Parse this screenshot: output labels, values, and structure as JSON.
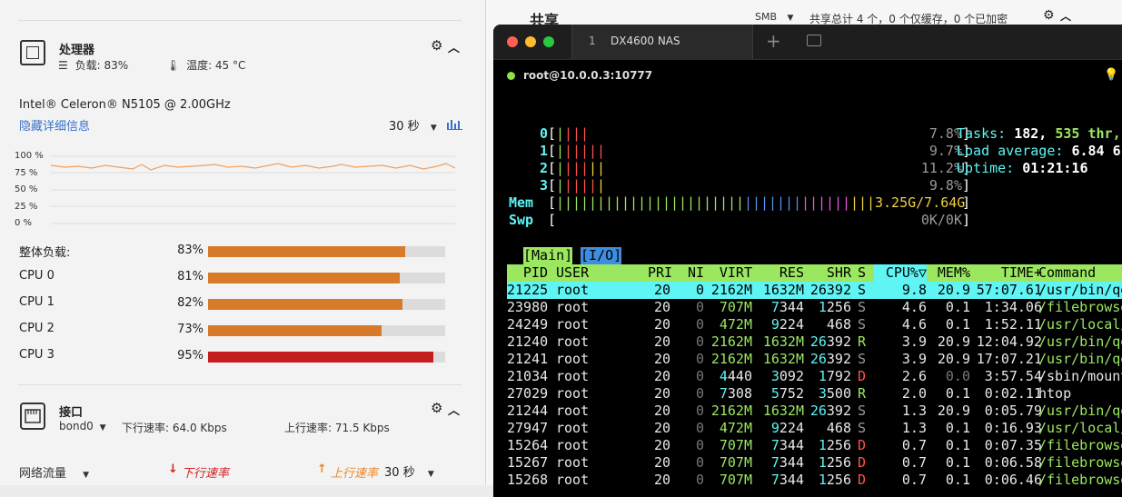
{
  "processor": {
    "title": "处理器",
    "load_label": "负载: 83%",
    "temp_label": "温度: 45 °C",
    "cpu_model": "Intel® Celeron® N5105 @ 2.00GHz",
    "hide_details": "隐藏详细信息",
    "interval": "30 秒",
    "axis_labels": [
      "100 %",
      "75 %",
      "50 %",
      "25 %",
      "0 %"
    ],
    "rows": [
      {
        "label": "整体负载:",
        "pct": "83%",
        "value": 83,
        "color": "#d77a2a"
      },
      {
        "label": "CPU 0",
        "pct": "81%",
        "value": 81,
        "color": "#d77a2a"
      },
      {
        "label": "CPU 1",
        "pct": "82%",
        "value": 82,
        "color": "#d77a2a"
      },
      {
        "label": "CPU 2",
        "pct": "73%",
        "value": 73,
        "color": "#d77a2a"
      },
      {
        "label": "CPU 3",
        "pct": "95%",
        "value": 95,
        "color": "#c41e1e"
      }
    ]
  },
  "interface": {
    "title": "接口",
    "adapter": "bond0",
    "down_rate": "下行速率: 64.0 Kbps",
    "up_rate": "上行速率: 71.5 Kbps",
    "traffic_label": "网络流量",
    "down_legend": "下行速率",
    "up_legend": "上行速率",
    "interval": "30 秒"
  },
  "share": {
    "title": "共享",
    "protocol": "SMB",
    "summary": "共享总计 4 个，0 个仅缓存，0 个已加密"
  },
  "terminal": {
    "tab_index": "1",
    "tab_title": "DX4600 NAS",
    "session": "root@10.0.0.3:10777",
    "cpu_bars": [
      {
        "id": "0",
        "percent": "7.8%"
      },
      {
        "id": "1",
        "percent": "9.7%"
      },
      {
        "id": "2",
        "percent": "11.2%"
      },
      {
        "id": "3",
        "percent": "9.8%"
      }
    ],
    "mem_label": "Mem",
    "mem_value": "3.25G/7.64G",
    "swp_label": "Swp",
    "swp_value": "0K/0K",
    "tasks_label": "Tasks:",
    "tasks_value": "182,",
    "threads_value": "535 thr,",
    "load_label": "Load average:",
    "load_value": "6.84 6",
    "uptime_label": "Uptime:",
    "uptime_value": "01:21:16",
    "tab_main": "[Main]",
    "tab_io": "[I/O]",
    "columns": [
      "PID",
      "USER",
      "PRI",
      "NI",
      "VIRT",
      "RES",
      "SHR",
      "S",
      "CPU%▽",
      "MEM%",
      "TIME+",
      "Command"
    ],
    "processes": [
      [
        "21225",
        "root",
        "20",
        "0",
        "2162M",
        "1632M",
        "26392",
        "S",
        "9.8",
        "20.9",
        "57:07.61",
        "/usr/bin/qe"
      ],
      [
        "23980",
        "root",
        "20",
        "0",
        "707M",
        "7344",
        "1256",
        "S",
        "4.6",
        "0.1",
        "1:34.06",
        "/filebrowse"
      ],
      [
        "24249",
        "root",
        "20",
        "0",
        "472M",
        "9224",
        "468",
        "S",
        "4.6",
        "0.1",
        "1:52.11",
        "/usr/local/"
      ],
      [
        "21240",
        "root",
        "20",
        "0",
        "2162M",
        "1632M",
        "26392",
        "R",
        "3.9",
        "20.9",
        "12:04.92",
        "/usr/bin/qe"
      ],
      [
        "21241",
        "root",
        "20",
        "0",
        "2162M",
        "1632M",
        "26392",
        "S",
        "3.9",
        "20.9",
        "17:07.21",
        "/usr/bin/qe"
      ],
      [
        "21034",
        "root",
        "20",
        "0",
        "4440",
        "3092",
        "1792",
        "D",
        "2.6",
        "0.0",
        "3:57.54",
        "/sbin/mount"
      ],
      [
        "27029",
        "root",
        "20",
        "0",
        "7308",
        "5752",
        "3500",
        "R",
        "2.0",
        "0.1",
        "0:02.11",
        "htop"
      ],
      [
        "21244",
        "root",
        "20",
        "0",
        "2162M",
        "1632M",
        "26392",
        "S",
        "1.3",
        "20.9",
        "0:05.79",
        "/usr/bin/qe"
      ],
      [
        "27947",
        "root",
        "20",
        "0",
        "472M",
        "9224",
        "468",
        "S",
        "1.3",
        "0.1",
        "0:16.93",
        "/usr/local/"
      ],
      [
        "15264",
        "root",
        "20",
        "0",
        "707M",
        "7344",
        "1256",
        "D",
        "0.7",
        "0.1",
        "0:07.35",
        "/filebrowse"
      ],
      [
        "15267",
        "root",
        "20",
        "0",
        "707M",
        "7344",
        "1256",
        "D",
        "0.7",
        "0.1",
        "0:06.58",
        "/filebrowse"
      ],
      [
        "15268",
        "root",
        "20",
        "0",
        "707M",
        "7344",
        "1256",
        "D",
        "0.7",
        "0.1",
        "0:06.46",
        "/filebrowse"
      ]
    ]
  },
  "colors": {
    "accent": "#3a72c9",
    "orange": "#d77a2a",
    "red": "#c41e1e",
    "term_cyan": "#5ff5f5",
    "term_green": "#9be860"
  }
}
